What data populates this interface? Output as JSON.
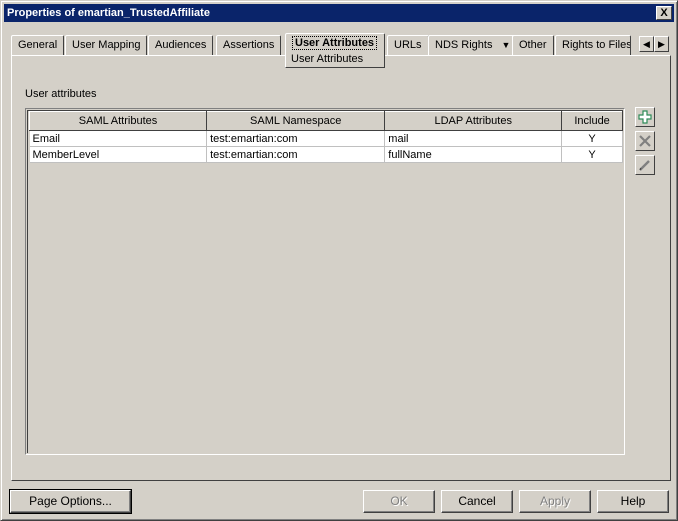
{
  "window": {
    "title": "Properties of emartian_TrustedAffiliate",
    "close_label": "X"
  },
  "tabs": [
    {
      "label": "General"
    },
    {
      "label": "User Mapping"
    },
    {
      "label": "Audiences"
    },
    {
      "label": "Assertions"
    },
    {
      "label": "User Attributes"
    },
    {
      "label": "URLs"
    },
    {
      "label": "NDS Rights"
    },
    {
      "label": "Other"
    },
    {
      "label": "Rights to Files"
    }
  ],
  "active_subtab": "User Attributes",
  "section_label": "User attributes",
  "table": {
    "columns": [
      "SAML Attributes",
      "SAML Namespace",
      "LDAP Attributes",
      "Include"
    ],
    "rows": [
      {
        "saml": "Email",
        "namespace": "test:emartian:com",
        "ldap": "mail",
        "include": "Y"
      },
      {
        "saml": "MemberLevel",
        "namespace": "test:emartian:com",
        "ldap": "fullName",
        "include": "Y"
      }
    ]
  },
  "buttons": {
    "page_options": "Page Options...",
    "ok": "OK",
    "cancel": "Cancel",
    "apply": "Apply",
    "help": "Help"
  },
  "colors": {
    "titlebar": "#0a246a",
    "face": "#d4d0c8",
    "add_icon": "#2e8b57"
  }
}
